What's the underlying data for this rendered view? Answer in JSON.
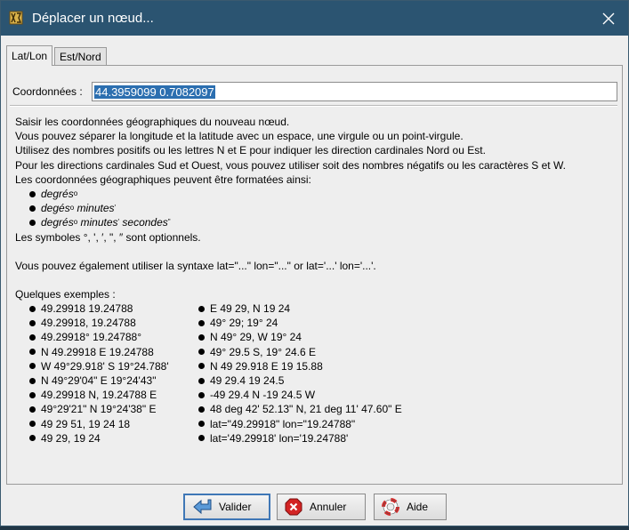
{
  "window": {
    "title": "Déplacer un nœud...",
    "close_glyph": "✕"
  },
  "tabs": [
    {
      "label": "Lat/Lon",
      "selected": true
    },
    {
      "label": "Est/Nord",
      "selected": false
    }
  ],
  "coordinates": {
    "label": "Coordonnées :",
    "value": "44.3959099 0.7082097"
  },
  "help": {
    "lines": [
      "Saisir les coordonnées géographiques du nouveau nœud.",
      "Vous pouvez séparer la longitude et la latitude avec un espace, une virgule ou un point-virgule.",
      "Utilisez des nombres positifs ou les lettres N et E pour indiquer les direction cardinales Nord ou Est.",
      "Pour les directions cardinales Sud et Ouest, vous pouvez utiliser soit des nombres négatifs ou les caractères S et W.",
      "Les coordonnées géographiques peuvent être formatées ainsi:"
    ],
    "formats": {
      "f1": {
        "w1": "degrés",
        "s1": "o"
      },
      "f2": {
        "w1": "degés",
        "s1": "o",
        "w2": "minutes",
        "s2": "'"
      },
      "f3": {
        "w1": "degrés",
        "s1": "o",
        "w2": "minutes",
        "s2": "'",
        "w3": "secondes",
        "s3": "\""
      }
    },
    "symbols_note": "Les symboles °, ', ′, \", ″ sont optionnels.",
    "syntax_note": "Vous pouvez également utiliser la syntaxe lat=\"...\" lon=\"...\" or lat='...' lon='...'.",
    "examples_title": "Quelques exemples :"
  },
  "examples_left": [
    "49.29918 19.24788",
    "49.29918, 19.24788",
    "49.29918° 19.24788°",
    "N 49.29918 E 19.24788",
    "W 49°29.918' S 19°24.788'",
    "N 49°29'04\" E 19°24'43\"",
    "49.29918 N, 19.24788 E",
    "49°29'21\" N 19°24'38\" E",
    "49 29 51, 19 24 18",
    "49 29, 19 24"
  ],
  "examples_right": [
    "E 49 29, N 19 24",
    "49° 29; 19° 24",
    "N 49° 29, W 19° 24",
    "49° 29.5 S, 19° 24.6 E",
    "N 49 29.918 E 19 15.88",
    "49 29.4 19 24.5",
    "-49 29.4 N -19 24.5 W",
    "48 deg 42' 52.13\" N, 21 deg 11' 47.60\" E",
    "lat=\"49.29918\" lon=\"19.24788\"",
    "lat='49.29918' lon='19.24788'"
  ],
  "buttons": {
    "ok": "Valider",
    "cancel": "Annuler",
    "help": "Aide"
  },
  "colors": {
    "titlebar": "#2b5471",
    "selection": "#2c6fb0",
    "dialog_bg": "#eeeeee"
  }
}
